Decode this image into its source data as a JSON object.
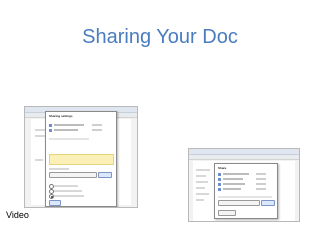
{
  "slide": {
    "title": "Sharing Your Doc",
    "caption": "Video"
  },
  "screenshots": {
    "left": {
      "description": "Sharing settings dialog over document editor",
      "dialog_title": "Sharing settings"
    },
    "right": {
      "description": "Share dialog over spreadsheet-like editor",
      "dialog_title": "Share"
    }
  },
  "colors": {
    "title": "#4a7dbf",
    "dialog_highlight": "#fbf1b8",
    "icon_blue": "#6b8fd0"
  }
}
